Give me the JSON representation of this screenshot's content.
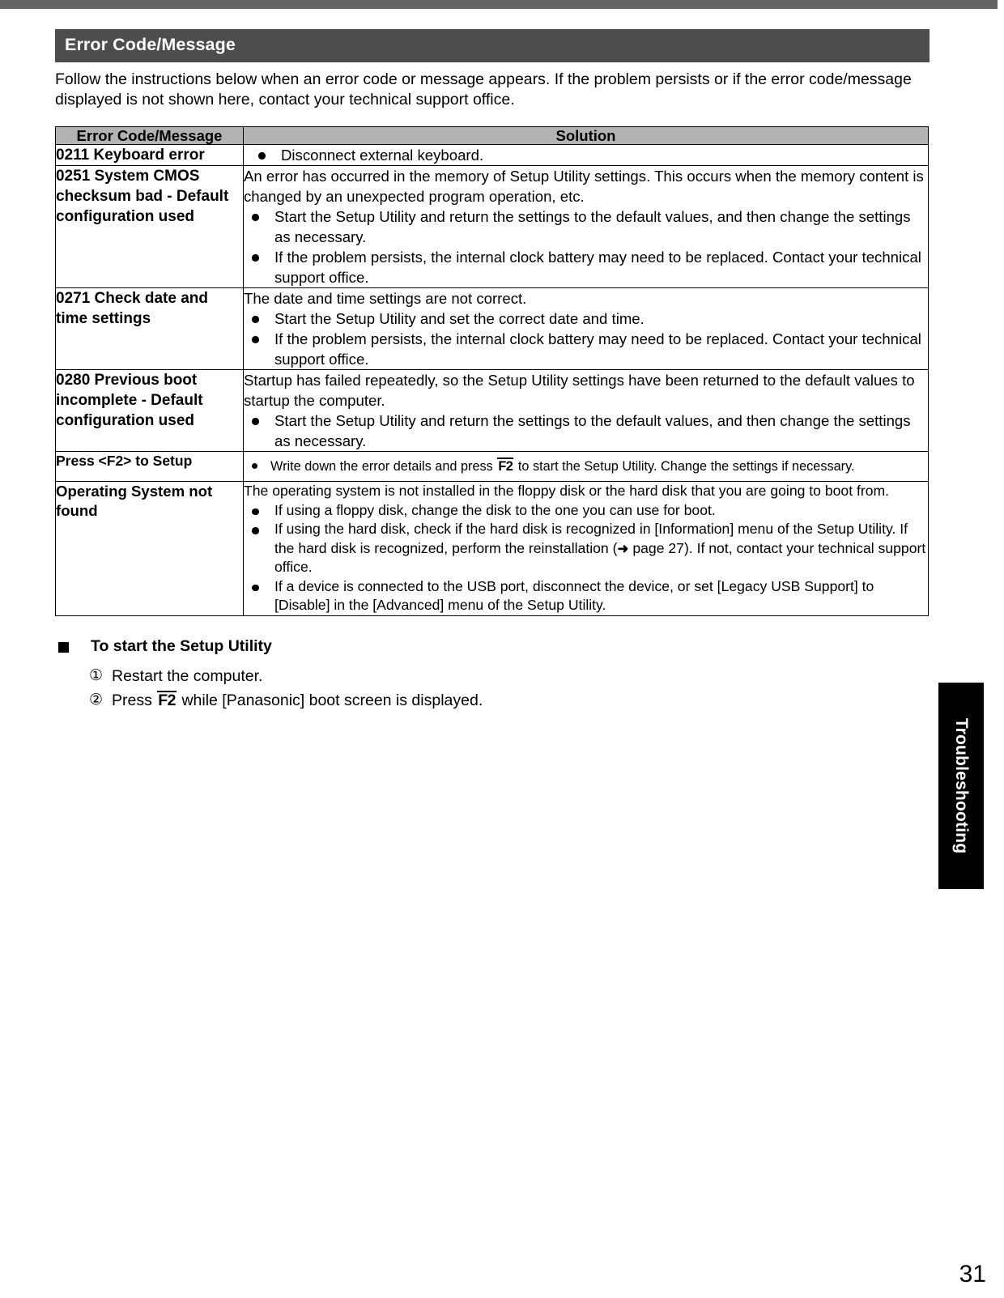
{
  "document": {
    "page_number": "31",
    "side_tab_label": "Troubleshooting",
    "section_title": "Error Code/Message",
    "intro": "Follow the instructions below when an error code or message appears. If the problem persists or if the error code/message displayed is not shown here, contact your technical support office."
  },
  "table": {
    "headers": {
      "col1": "Error Code/Message",
      "col2": "Solution"
    },
    "rows": [
      {
        "code": "0211 Keyboard error",
        "lead": "",
        "bullets": [
          "Disconnect external keyboard."
        ]
      },
      {
        "code": "0251 System CMOS checksum bad - Default configuration used",
        "lead": "An error has occurred in the memory of Setup Utility settings. This occurs when the memory content is changed by an unexpected program operation, etc.",
        "bullets": [
          "Start the Setup Utility and return the settings to the default values, and then change the settings as necessary.",
          "If the problem persists, the internal clock battery may need to be replaced. Contact your technical support office."
        ]
      },
      {
        "code": "0271 Check date and time settings",
        "lead": "The date and time settings are not correct.",
        "bullets": [
          "Start the Setup Utility and set the correct date and time.",
          "If the problem persists, the internal clock battery may need to be replaced. Contact your technical support office."
        ]
      },
      {
        "code": "0280 Previous boot incomplete - Default configuration used",
        "lead": "Startup has failed repeatedly, so the Setup Utility settings have been returned to the default values to startup the computer.",
        "bullets": [
          "Start the Setup Utility and return the settings to the default values, and then change the settings as necessary."
        ]
      },
      {
        "code": "Press <F2> to Setup",
        "lead": "",
        "bullet_f2": {
          "before": "Write down the error details and press ",
          "key": "F2",
          "after": " to start the Setup Utility. Change the settings if necessary."
        }
      },
      {
        "code": "Operating System not found",
        "lead": "The operating system is not installed in the floppy disk or the hard disk that you are going to boot from.",
        "bullets": [
          "If using a floppy disk, change the disk to the one you can use for boot."
        ],
        "bullet_ref": {
          "before": "If using the hard disk, check if the hard disk is recognized in [Information] menu of the Setup Utility. If the hard disk is recognized, perform the reinstallation (",
          "arrow": "➜",
          "link": " page 27",
          "after": "). If not, contact your technical support office."
        },
        "bullets_tail": [
          "If a device is connected to the USB port, disconnect the device, or set [Legacy USB Support] to [Disable] in the [Advanced] menu of the Setup Utility."
        ]
      }
    ]
  },
  "subsection": {
    "heading": "To start the Setup Utility",
    "steps": [
      {
        "marker": "①",
        "before": "Restart the computer.",
        "key": "",
        "after": ""
      },
      {
        "marker": "②",
        "before": "Press ",
        "key": "F2",
        "after": " while [Panasonic] boot screen is displayed."
      }
    ]
  },
  "colors": {
    "top_rule": "#656565",
    "section_band": "#4d4d4d",
    "table_header": "#b3b3b3",
    "side_tab": "#000000"
  }
}
